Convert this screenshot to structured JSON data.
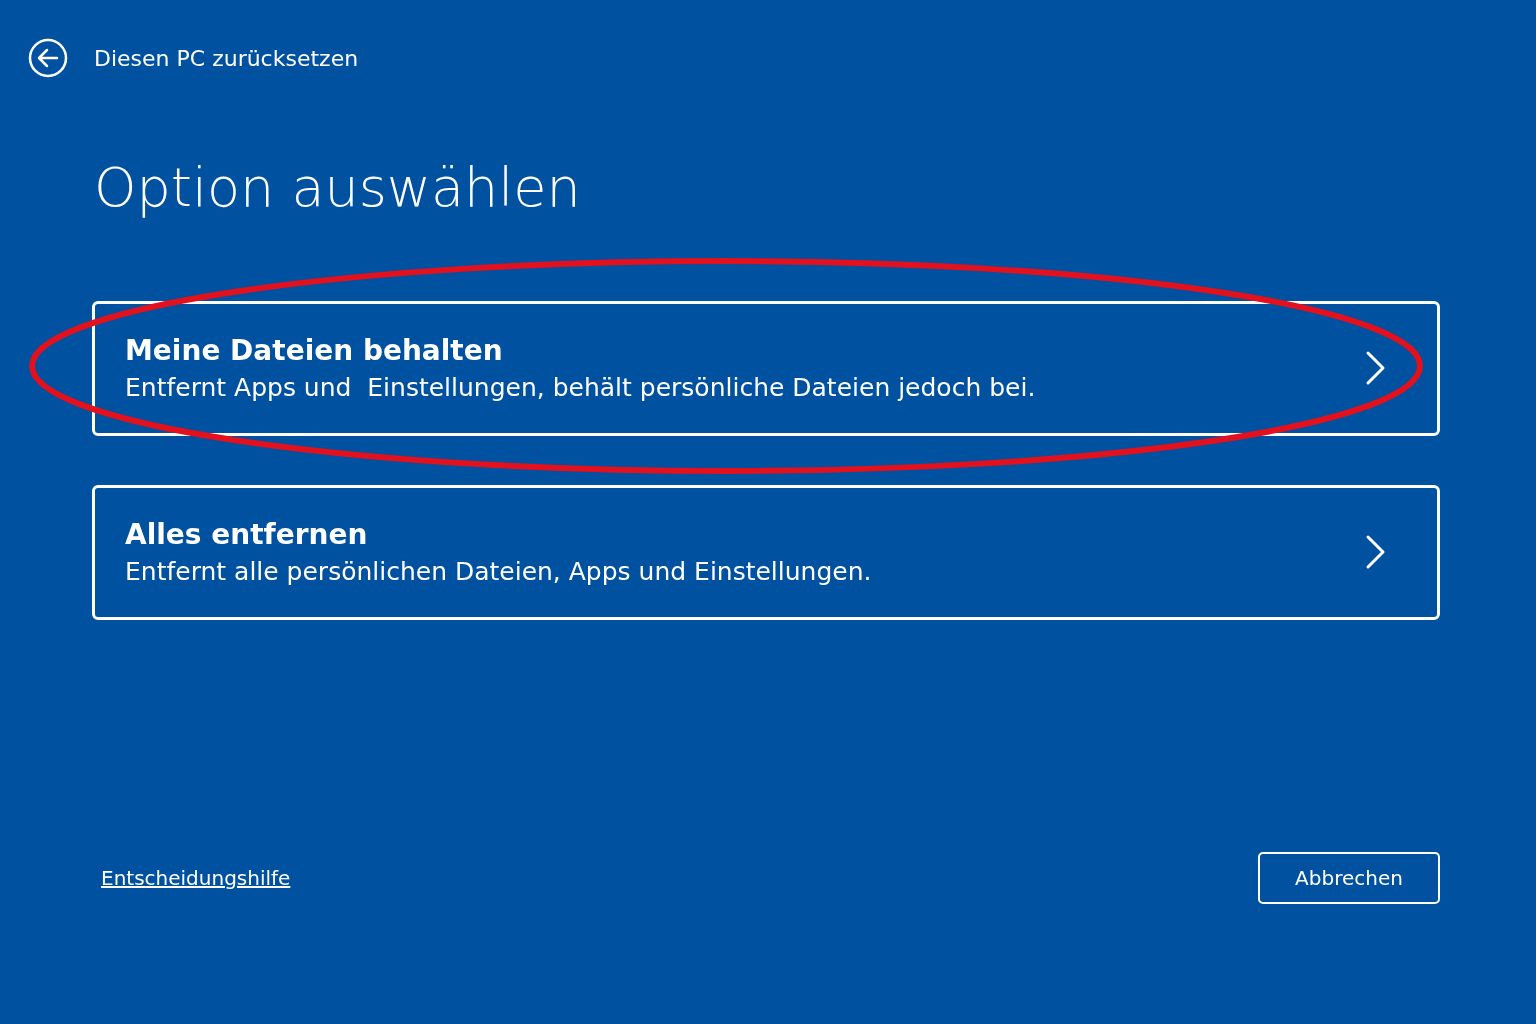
{
  "header": {
    "title": "Diesen PC zurücksetzen"
  },
  "heading": "Option auswählen",
  "options": [
    {
      "title": "Meine Dateien behalten",
      "description": "Entfernt Apps und  Einstellungen, behält persönliche Dateien jedoch bei.",
      "highlighted": true
    },
    {
      "title": "Alles entfernen",
      "description": "Entfernt alle persönlichen Dateien, Apps und Einstellungen.",
      "highlighted": false
    }
  ],
  "help_link": "Entscheidungshilfe",
  "cancel_button": "Abbrechen"
}
